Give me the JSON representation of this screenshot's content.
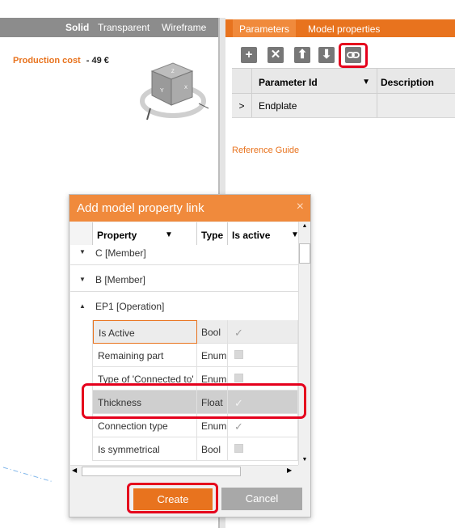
{
  "view": {
    "modes": [
      "Solid",
      "Transparent",
      "Wireframe"
    ],
    "production_cost_label": "Production cost",
    "production_cost_value": "- 49 €",
    "cube_faces": [
      "Z",
      "Y",
      "X"
    ]
  },
  "right_panel": {
    "tabs": [
      "Parameters",
      "Model properties"
    ],
    "toolbar_icons": [
      "add-icon",
      "delete-icon",
      "move-up-icon",
      "move-down-icon",
      "link-icon"
    ],
    "table_headers": [
      "Parameter Id",
      "Description"
    ],
    "rows": [
      {
        "expander": ">",
        "id": "Endplate",
        "description": ""
      }
    ],
    "reference_guide": "Reference Guide"
  },
  "dialog": {
    "title": "Add model property link",
    "close": "×",
    "headers": [
      "Property",
      "Type",
      "Is active"
    ],
    "groups": [
      {
        "label": "C [Member]",
        "expanded": false
      },
      {
        "label": "B [Member]",
        "expanded": false
      },
      {
        "label": "EP1 [Operation]",
        "expanded": true
      }
    ],
    "items": [
      {
        "name": "Is Active",
        "type": "Bool",
        "checked": true
      },
      {
        "name": "Remaining part",
        "type": "Enum",
        "checked": false
      },
      {
        "name": "Type of 'Connected to'",
        "type": "Enum",
        "checked": false
      },
      {
        "name": "Thickness",
        "type": "Float",
        "checked": true
      },
      {
        "name": "Connection type",
        "type": "Enum",
        "checked": true
      },
      {
        "name": "Is symmetrical",
        "type": "Bool",
        "checked": false
      }
    ],
    "create_label": "Create",
    "cancel_label": "Cancel"
  }
}
